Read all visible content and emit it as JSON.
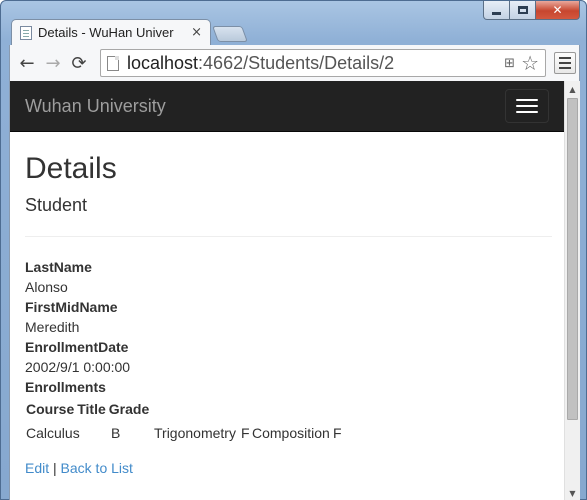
{
  "browser": {
    "tab_title": "Details - WuHan Univer",
    "tab_close": "×",
    "url_host": "localhost",
    "url_rest": ":4662/Students/Details/2",
    "back_glyph": "←",
    "forward_glyph": "→",
    "reload_glyph": "⟳",
    "translate_glyph": "⊞",
    "star_glyph": "☆",
    "close_glyph": "✕",
    "scroll_up_glyph": "▲",
    "scroll_down_glyph": "▼"
  },
  "navbar": {
    "brand": "Wuhan University"
  },
  "page": {
    "title": "Details",
    "subtitle": "Student",
    "fields": [
      {
        "label": "LastName",
        "value": "Alonso"
      },
      {
        "label": "FirstMidName",
        "value": "Meredith"
      },
      {
        "label": "EnrollmentDate",
        "value": "2002/9/1 0:00:00"
      }
    ],
    "enrollments_label": "Enrollments",
    "enrollments_table": {
      "headers": [
        "Course",
        "Title",
        "Grade"
      ],
      "rows": [
        [
          "Calculus",
          "",
          "B",
          "",
          "Trigonometry",
          "F",
          "Composition",
          "F"
        ]
      ]
    },
    "links": {
      "edit": "Edit",
      "separator": "|",
      "back": "Back to List"
    }
  },
  "colors": {
    "navbar_bg": "#222222",
    "brand_text": "#9d9d9d",
    "link": "#428bca",
    "text": "#333333"
  }
}
